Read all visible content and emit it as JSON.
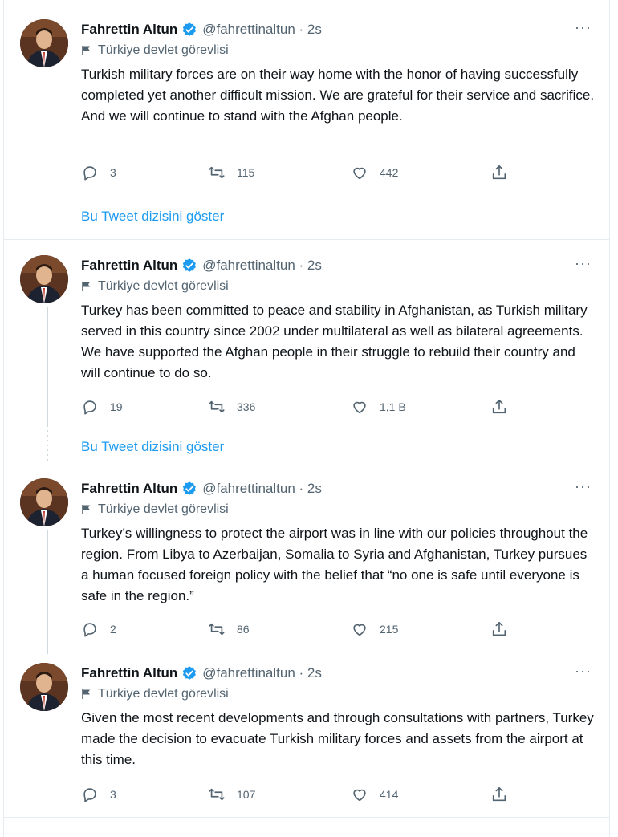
{
  "tweets": [
    {
      "author": "Fahrettin Altun",
      "handle": "@fahrettinaltun · 2s",
      "label": "Türkiye devlet görevlisi",
      "text": "Turkish military forces are on their way home with the honor of having successfully completed yet another difficult mission. We are grateful for their service and sacrifice. And we will continue to stand with the Afghan people.",
      "replies": "3",
      "retweets": "115",
      "likes": "442",
      "show_thread": "Bu Tweet dizisini göster"
    },
    {
      "author": "Fahrettin Altun",
      "handle": "@fahrettinaltun · 2s",
      "label": "Türkiye devlet görevlisi",
      "text": "Turkey has been committed to peace and stability in Afghanistan, as Turkish military served in this country since 2002 under multilateral as well as bilateral agreements. We have supported the Afghan people in their struggle to rebuild their country and will continue to do so.",
      "replies": "19",
      "retweets": "336",
      "likes": "1,1 B",
      "show_thread": "Bu Tweet dizisini göster"
    },
    {
      "author": "Fahrettin Altun",
      "handle": "@fahrettinaltun · 2s",
      "label": "Türkiye devlet görevlisi",
      "text": "Turkey’s willingness to protect the airport was in line with our policies throughout the region. From Libya to Azerbaijan, Somalia to Syria and Afghanistan, Turkey pursues a human focused foreign policy with the belief that “no one is safe until everyone is safe in the region.”",
      "replies": "2",
      "retweets": "86",
      "likes": "215"
    },
    {
      "author": "Fahrettin Altun",
      "handle": "@fahrettinaltun · 2s",
      "label": "Türkiye devlet görevlisi",
      "text": "Given the most recent developments and through consultations with partners, Turkey made the decision to evacuate Turkish military forces and assets from the airport at this time.",
      "replies": "3",
      "retweets": "107",
      "likes": "414"
    }
  ],
  "more_glyph": "···",
  "icons": [
    "verified-badge-icon",
    "flag-icon",
    "reply-icon",
    "retweet-icon",
    "like-icon",
    "share-icon"
  ],
  "colors": {
    "accent": "#1d9bf0",
    "muted": "#536471",
    "border": "#e6ecf0"
  }
}
